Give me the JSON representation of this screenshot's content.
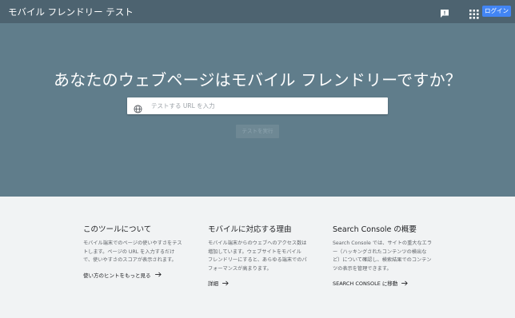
{
  "header": {
    "title": "モバイル フレンドリー テスト",
    "login_label": "ログイン",
    "icons": {
      "feedback": "feedback-icon",
      "apps": "apps-grid-icon"
    }
  },
  "hero": {
    "heading": "あなたのウェブページはモバイル フレンドリーですか？",
    "url_placeholder": "テストする URL を入力",
    "url_value": "",
    "run_label": "テストを実行",
    "icons": {
      "input": "globe-icon"
    }
  },
  "info": {
    "columns": [
      {
        "title": "このツールについて",
        "body": "モバイル端末でのページの使いやすさをテストします。ページの URL を入力するだけで、使いやすさのスコアが表示されます。",
        "link": "使い方のヒントをもっと見る"
      },
      {
        "title": "モバイルに対応する理由",
        "body": "モバイル端末からのウェブへのアクセス数は増加しています。ウェブサイトをモバイル フレンドリーにすると、あらゆる端末でのパフォーマンスが高まります。",
        "link": "詳細"
      },
      {
        "title": "Search Console の概要",
        "body": "Search Console では、サイトの重大なエラー（ハッキングされたコンテンツの検出など）について確認し、検索結果でのコンテンツの表示を管理できます。",
        "link": "SEARCH CONSOLE に移動"
      }
    ]
  },
  "colors": {
    "header_bg": "#4d6370",
    "hero_bg": "#607d8b",
    "login_bg": "#4285f4",
    "info_bg": "#f1f3f4"
  }
}
